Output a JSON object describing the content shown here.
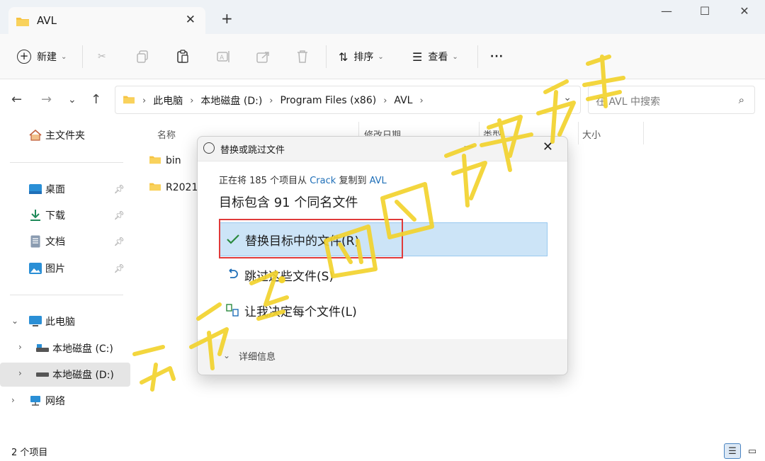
{
  "tab": {
    "title": "AVL"
  },
  "toolbar": {
    "new_label": "新建",
    "sort_label": "排序",
    "view_label": "查看",
    "more_label": "···"
  },
  "address": {
    "crumbs": [
      "此电脑",
      "本地磁盘 (D:)",
      "Program Files (x86)",
      "AVL"
    ]
  },
  "search": {
    "placeholder": "在 AVL 中搜索"
  },
  "sidebar": {
    "home": "主文件夹",
    "quick": [
      {
        "label": "桌面",
        "icon": "desktop-icon"
      },
      {
        "label": "下载",
        "icon": "download-icon"
      },
      {
        "label": "文档",
        "icon": "document-icon"
      },
      {
        "label": "图片",
        "icon": "pictures-icon"
      }
    ],
    "this_pc": "此电脑",
    "drives": [
      "本地磁盘 (C:)",
      "本地磁盘 (D:)"
    ],
    "network": "网络"
  },
  "columns": {
    "name": "名称",
    "modified": "修改日期",
    "type": "类型",
    "size": "大小"
  },
  "files": [
    "bin",
    "R2021"
  ],
  "status": {
    "count": "2 个项目"
  },
  "dialog": {
    "title": "替换或跳过文件",
    "line1_prefix": "正在将 185 个项目从",
    "source": "Crack",
    "line1_mid": "复制到",
    "dest": "AVL",
    "line2": "目标包含 91 个同名文件",
    "opt_replace": "替换目标中的文件(R)",
    "opt_skip": "跳过这些文件(S)",
    "opt_decide": "让我决定每个文件(L)",
    "details": "详细信息"
  },
  "colors": {
    "accent": "#1f6fb8",
    "highlight": "#cce4f7",
    "redbox": "#e03a3a",
    "check": "#2b8a3e",
    "folder": "#f6c342"
  }
}
